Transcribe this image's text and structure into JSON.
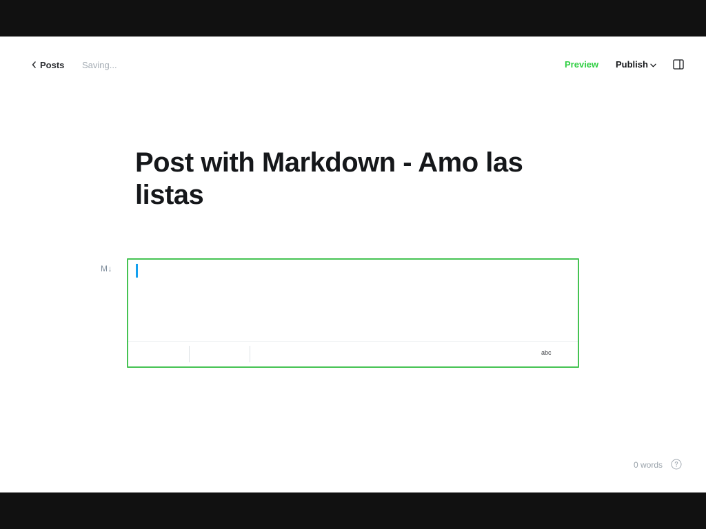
{
  "header": {
    "back_label": "Posts",
    "save_status": "Saving...",
    "preview_label": "Preview",
    "publish_label": "Publish"
  },
  "post": {
    "title": "Post with Markdown - Amo las listas"
  },
  "editor": {
    "card_type_label": "M↓",
    "content": "",
    "spellcheck_label": "abc",
    "accent_color": "#45c353",
    "cursor_color": "#14a0ef"
  },
  "footer": {
    "word_count": "0 words"
  },
  "icons": {
    "back": "chevron-left-icon",
    "publish_menu": "chevron-down-icon",
    "sidebar": "sidebar-panel-icon",
    "help": "question-circle-icon"
  },
  "colors": {
    "preview": "#30cf43",
    "page_bg": "#ffffff",
    "frame_bg": "#111111"
  }
}
